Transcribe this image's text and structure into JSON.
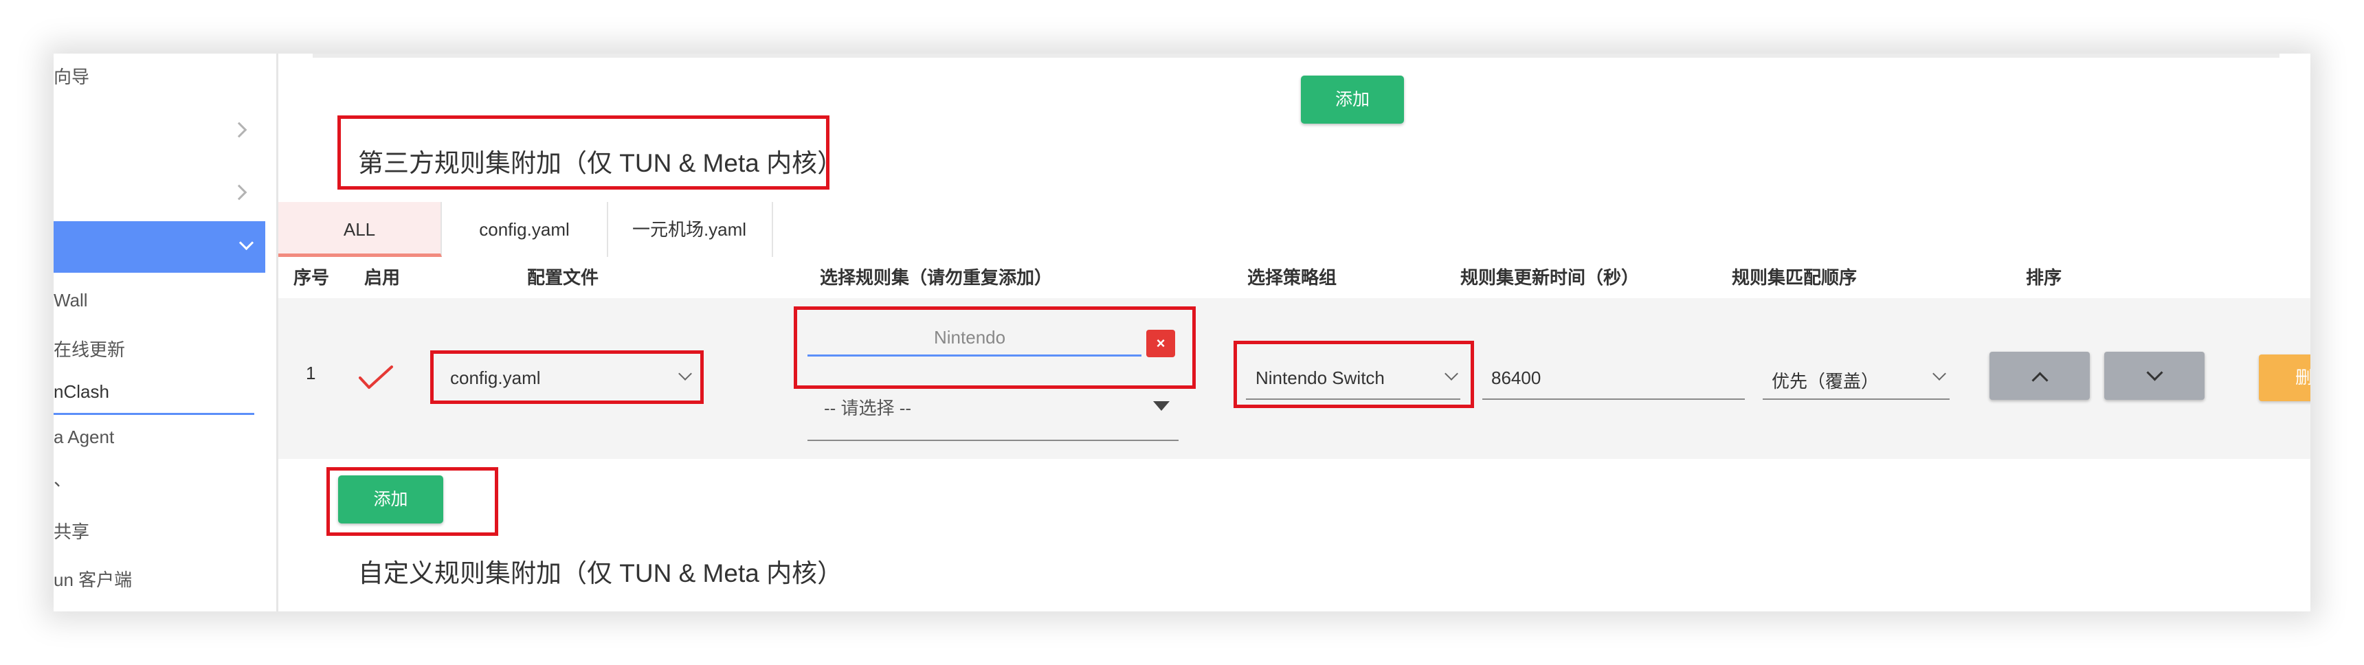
{
  "sidebar": {
    "items": [
      {
        "label": "向导"
      },
      {
        "label": ""
      },
      {
        "label": ""
      },
      {
        "label": ""
      },
      {
        "label": "Wall"
      },
      {
        "label": "在线更新"
      },
      {
        "label": "nClash"
      },
      {
        "label": "a Agent"
      },
      {
        "label": "、"
      },
      {
        "label": "共享"
      },
      {
        "label": "un 客户端"
      }
    ],
    "accent": "#5b8ff9"
  },
  "top": {
    "add_label": "添加"
  },
  "third_party": {
    "title": "第三方规则集附加（仅 TUN & Meta 内核）",
    "tabs": [
      {
        "label": "ALL"
      },
      {
        "label": "config.yaml"
      },
      {
        "label": "一元机场.yaml"
      }
    ],
    "headers": {
      "index": "序号",
      "enabled": "启用",
      "config_file": "配置文件",
      "rule_set": "选择规则集（请勿重复添加）",
      "policy_group": "选择策略组",
      "update_interval": "规则集更新时间（秒）",
      "match_order": "规则集匹配顺序",
      "sort": "排序"
    },
    "rows": [
      {
        "index": "1",
        "enabled_icon": "check-icon",
        "config_file": "config.yaml",
        "rule_set_value": "Nintendo",
        "rule_set_placeholder": "-- 请选择 --",
        "policy_group": "Nintendo Switch",
        "update_interval": "86400",
        "match_order": "优先（覆盖）",
        "delete_label": "删除"
      }
    ],
    "add_label": "添加"
  },
  "custom": {
    "title": "自定义规则集附加（仅 TUN & Meta 内核）"
  },
  "colors": {
    "green": "#2bb673",
    "highlight_red": "#e0141e",
    "delete_orange": "#f7b44d",
    "sort_grey": "#a7abb2",
    "check_red": "#e53935",
    "remove_red": "#e53935"
  }
}
